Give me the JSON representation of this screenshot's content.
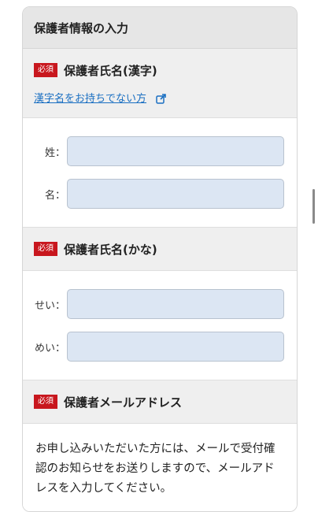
{
  "form": {
    "header": "保護者情報の入力",
    "required_badge": "必須",
    "kanji": {
      "title": "保護者氏名(漢字)",
      "link": "漢字名をお持ちでない方",
      "last_label": "姓：",
      "first_label": "名："
    },
    "kana": {
      "title": "保護者氏名(かな)",
      "last_label": "せい：",
      "first_label": "めい："
    },
    "email": {
      "title": "保護者メールアドレス",
      "description": "お申し込みいただいた方には、メールで受付確認のお知らせをお送りしますので、メールアドレスを入力してください。"
    }
  },
  "colors": {
    "required_badge": "#c8171e",
    "link": "#1a6fc2",
    "input_bg": "#dce6f3"
  }
}
